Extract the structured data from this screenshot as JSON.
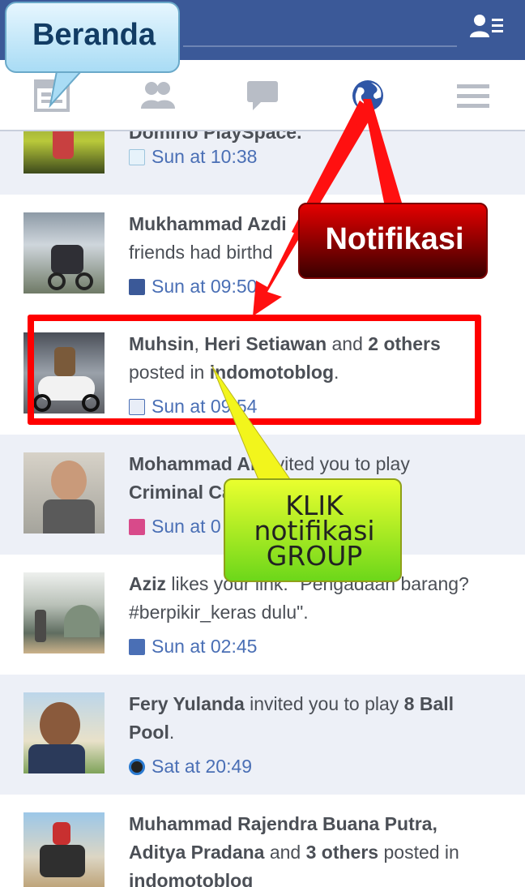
{
  "annotations": {
    "beranda": "Beranda",
    "notifikasi": "Notifikasi",
    "klik_lines": [
      "KLIK",
      "notifikasi",
      "GROUP"
    ]
  },
  "colors": {
    "brand_blue": "#3b5998",
    "unread_bg": "#edf0f7",
    "link_blue": "#4a6fb5",
    "highlight_red": "#ff0000"
  },
  "nav": {
    "icons": [
      "home-icon",
      "friends-icon",
      "messages-icon",
      "notifications-globe-icon",
      "menu-icon"
    ],
    "active": "notifications-globe-icon"
  },
  "notifications": [
    {
      "text_partial": "Domino PlaySpace.",
      "time": "Sun at 10:38",
      "app_icon": "domino-app-icon",
      "unread": true
    },
    {
      "actor": "Mukhammad Azdi",
      "line2": "friends had birthd",
      "time": "Sun at 09:50",
      "app_icon": "facebook-icon",
      "unread": false
    },
    {
      "actors": [
        "Muhsin",
        "Heri Setiawan"
      ],
      "and": "and",
      "others": "2 others",
      "posted_in": "posted in",
      "group": "indomotoblog",
      "time": "Sun at 09:54",
      "app_icon": "group-icon",
      "unread": true
    },
    {
      "actor": "Mohammad Al",
      "rest": "invited you to play",
      "game": "Criminal Ca",
      "time": "Sun at 0",
      "app_icon": "game-app-icon",
      "unread": true
    },
    {
      "actor": "Aziz",
      "rest": "likes your link: \"Pengadaan barang?",
      "line2": "#berpikir_keras dulu\".",
      "time": "Sun at 02:45",
      "app_icon": "like-icon",
      "unread": false
    },
    {
      "actor": "Fery Yulanda",
      "rest": "invited you to play",
      "game": "8 Ball",
      "game_line2": "Pool",
      "time": "Sat at 20:49",
      "app_icon": "8ball-app-icon",
      "unread": true
    },
    {
      "actor": "Muhammad Rajendra Buana Putra,",
      "actor2": "Aditya Pradana",
      "and": "and",
      "others": "3 others",
      "posted_in": "posted in",
      "group": "indomotoblog",
      "unread": false
    }
  ]
}
